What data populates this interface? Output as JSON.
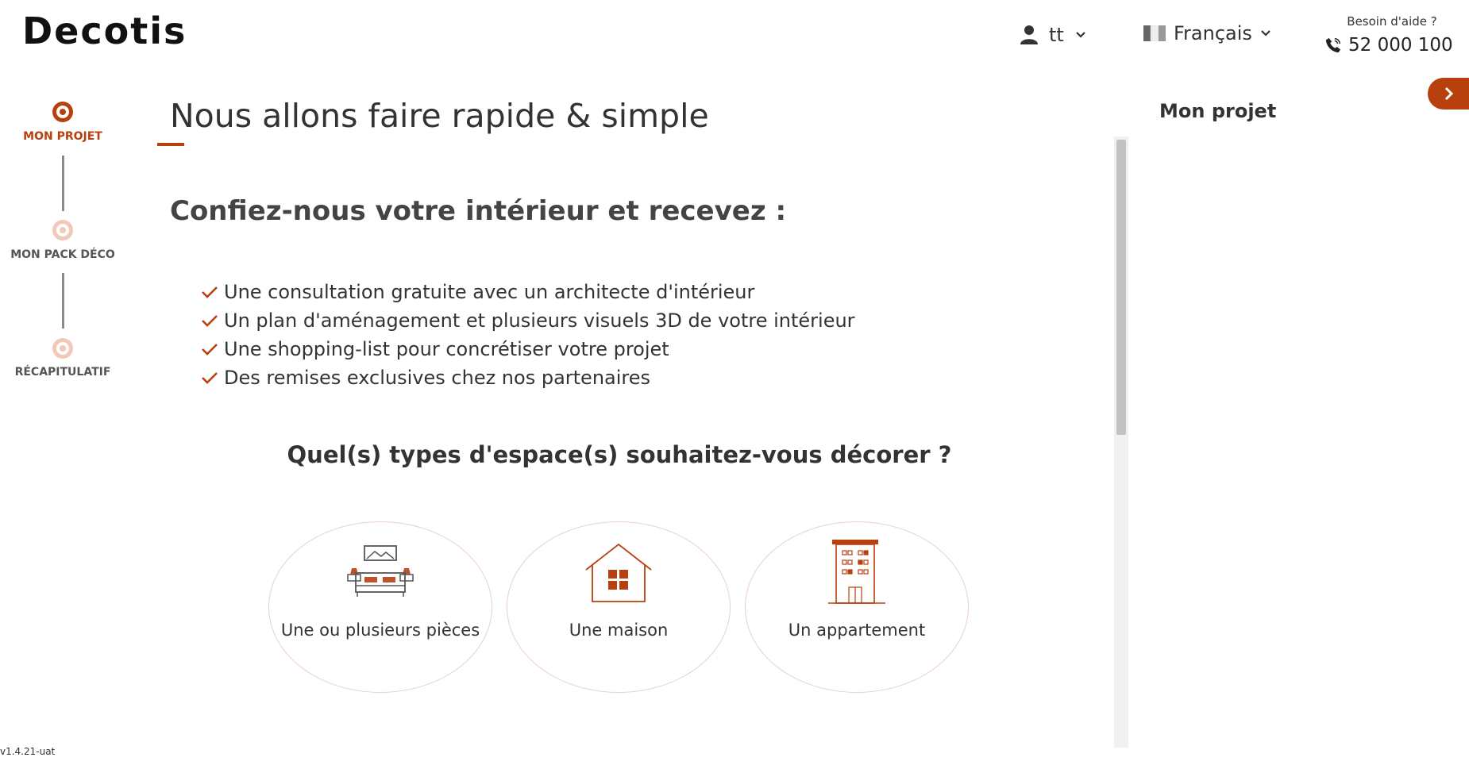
{
  "header": {
    "logo_text": "Decotis",
    "user_name": "tt",
    "language": "Français",
    "help_question": "Besoin d'aide ?",
    "phone": "52 000 100"
  },
  "steps": [
    {
      "label": "MON PROJET",
      "active": true
    },
    {
      "label": "MON PACK DÉCO",
      "active": false
    },
    {
      "label": "RÉCAPITULATIF",
      "active": false
    }
  ],
  "main": {
    "title": "Nous allons faire rapide & simple",
    "subtitle": "Confiez-nous votre intérieur et recevez :",
    "benefits": [
      "Une consultation gratuite avec un architecte d'intérieur",
      "Un plan d'aménagement et plusieurs visuels 3D de votre intérieur",
      "Une shopping-list pour concrétiser votre projet",
      "Des remises exclusives chez nos partenaires"
    ],
    "question": "Quel(s) types d'espace(s) souhaitez-vous décorer ?",
    "options": [
      {
        "label": "Une ou plusieurs pièces",
        "icon": "bedroom-icon"
      },
      {
        "label": "Une maison",
        "icon": "house-icon"
      },
      {
        "label": "Un appartement",
        "icon": "apartment-building-icon"
      }
    ]
  },
  "panel": {
    "title": "Mon projet"
  },
  "version": "v1.4.21-uat",
  "colors": {
    "accent": "#b8400f",
    "accent_light": "#e8b6a0",
    "text": "#333333"
  }
}
